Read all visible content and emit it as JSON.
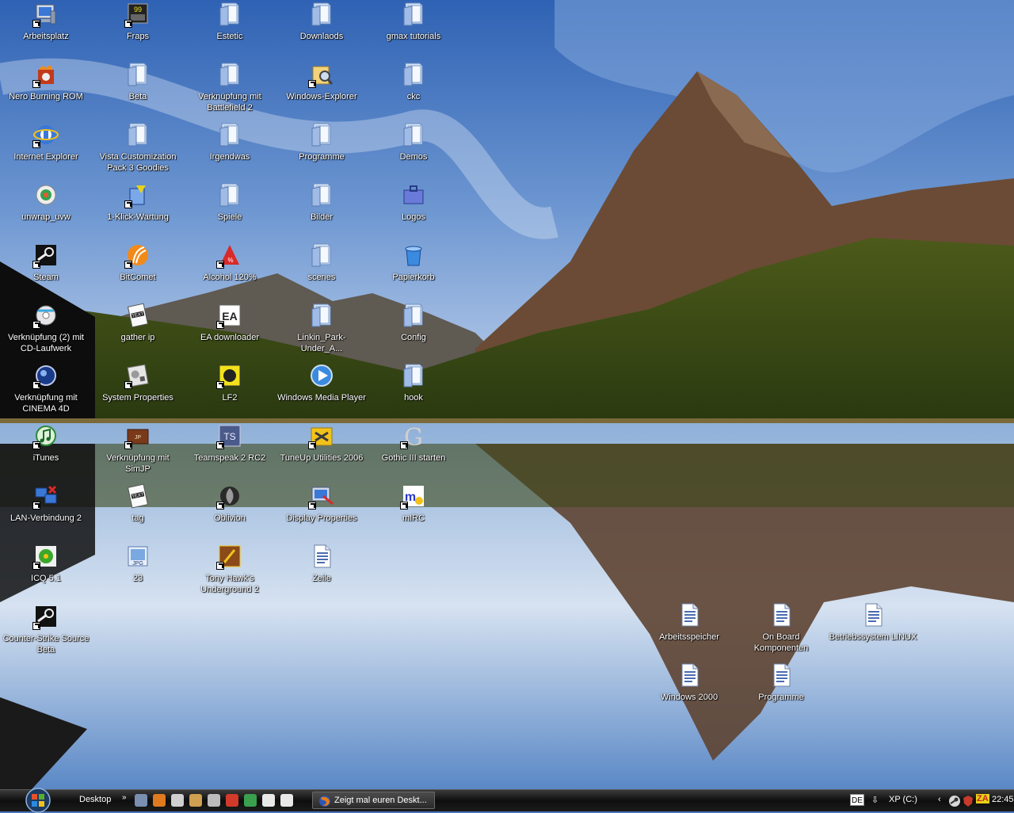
{
  "desktop": {
    "icons": [
      {
        "label": "Arbeitsplatz",
        "icon": "my-computer-icon"
      },
      {
        "label": "Nero Burning ROM",
        "icon": "nero-icon"
      },
      {
        "label": "Internet Explorer",
        "icon": "internet-explorer-icon"
      },
      {
        "label": "unwrap_uvw",
        "icon": "unwrap-uvw-icon"
      },
      {
        "label": "Steam",
        "icon": "steam-icon"
      },
      {
        "label": "Verknüpfung (2) mit CD-Laufwerk",
        "icon": "cd-drive-icon"
      },
      {
        "label": "Verknüpfung mit CINEMA 4D",
        "icon": "cinema4d-icon"
      },
      {
        "label": "iTunes",
        "icon": "itunes-icon"
      },
      {
        "label": "LAN-Verbindung 2",
        "icon": "network-connection-icon"
      },
      {
        "label": "ICQ 5.1",
        "icon": "icq-icon"
      },
      {
        "label": "Counter-Strike Source Beta",
        "icon": "steam-icon"
      },
      {
        "label": "Fraps",
        "icon": "fraps-icon"
      },
      {
        "label": "Beta",
        "icon": "folder-icon"
      },
      {
        "label": "Vista Customization Pack 3 Goodies",
        "icon": "folder-icon"
      },
      {
        "label": "1-Klick-Wartung",
        "icon": "maintenance-icon"
      },
      {
        "label": "BitComet",
        "icon": "bitcomet-icon"
      },
      {
        "label": "gather ip",
        "icon": "text-file-icon"
      },
      {
        "label": "System Properties",
        "icon": "system-properties-icon"
      },
      {
        "label": "Verknüpfung mit SimJP",
        "icon": "simjp-icon"
      },
      {
        "label": "tag",
        "icon": "text-file-icon"
      },
      {
        "label": "23",
        "icon": "jpg-file-icon"
      },
      {
        "label": "Estetic",
        "icon": "folder-icon"
      },
      {
        "label": "Verknüpfung mit Battlefield 2",
        "icon": "folder-icon"
      },
      {
        "label": "Irgendwas",
        "icon": "folder-icon"
      },
      {
        "label": "Spiele",
        "icon": "folder-icon"
      },
      {
        "label": "Alcohol 120%",
        "icon": "alcohol-icon"
      },
      {
        "label": "EA downloader",
        "icon": "ea-icon"
      },
      {
        "label": "LF2",
        "icon": "lf2-icon"
      },
      {
        "label": "Teamspeak 2 RC2",
        "icon": "teamspeak-icon"
      },
      {
        "label": "Oblivion",
        "icon": "oblivion-icon"
      },
      {
        "label": "Tony Hawk's Underground 2",
        "icon": "tony-hawk-icon"
      },
      {
        "label": "Downlaods",
        "icon": "folder-icon"
      },
      {
        "label": "Windows-Explorer",
        "icon": "windows-explorer-icon"
      },
      {
        "label": "Programme",
        "icon": "folder-icon"
      },
      {
        "label": "Bilder",
        "icon": "folder-icon"
      },
      {
        "label": "scenes",
        "icon": "folder-icon"
      },
      {
        "label": "Linkin_Park-Under_A...",
        "icon": "folder-icon"
      },
      {
        "label": "Windows Media Player",
        "icon": "media-player-icon"
      },
      {
        "label": "TuneUp Utilities 2006",
        "icon": "tuneup-icon"
      },
      {
        "label": "Display Properties",
        "icon": "display-properties-icon"
      },
      {
        "label": "Zeile",
        "icon": "document-icon"
      },
      {
        "label": "gmax tutorials",
        "icon": "folder-icon"
      },
      {
        "label": "ckc",
        "icon": "folder-icon"
      },
      {
        "label": "Demos",
        "icon": "folder-icon"
      },
      {
        "label": "Logos",
        "icon": "briefcase-icon"
      },
      {
        "label": "Papierkorb",
        "icon": "recycle-bin-icon"
      },
      {
        "label": "Config",
        "icon": "folder-icon"
      },
      {
        "label": "hook",
        "icon": "folder-icon"
      },
      {
        "label": "Gothic III starten",
        "icon": "gothic-icon"
      },
      {
        "label": "mIRC",
        "icon": "mirc-icon"
      },
      {
        "label": "Arbeitsspeicher",
        "icon": "document-icon"
      },
      {
        "label": "On Board Komponenten",
        "icon": "document-icon"
      },
      {
        "label": "Betriebssystem LINUX",
        "icon": "document-icon"
      },
      {
        "label": "Windows 2000",
        "icon": "document-icon"
      },
      {
        "label": "Programme",
        "icon": "document-icon"
      }
    ]
  },
  "taskbar": {
    "toolbar_label": "Desktop",
    "toolbar_chevron": "»",
    "quick_launch": [
      {
        "icon": "network-icon",
        "color": "#7a8fb0"
      },
      {
        "icon": "firefox-icon",
        "color": "#e07a1f"
      },
      {
        "icon": "window-icon",
        "color": "#cfcfcf"
      },
      {
        "icon": "counter-strike-icon",
        "color": "#d0a050"
      },
      {
        "icon": "drive-icon",
        "color": "#bcbcbc"
      },
      {
        "icon": "game-2-icon",
        "color": "#d23a2a"
      },
      {
        "icon": "clover-icon",
        "color": "#3aa050"
      },
      {
        "icon": "note-icon",
        "color": "#e8e8e8"
      },
      {
        "icon": "note-icon",
        "color": "#e8e8e8"
      }
    ],
    "task_button_label": "Zeigt mal euren Deskt...",
    "tray": {
      "language": "DE",
      "drive_label": "XP (C:)",
      "chevron": "‹",
      "zonealarm_label": "ZA",
      "clock": "22:45"
    }
  }
}
